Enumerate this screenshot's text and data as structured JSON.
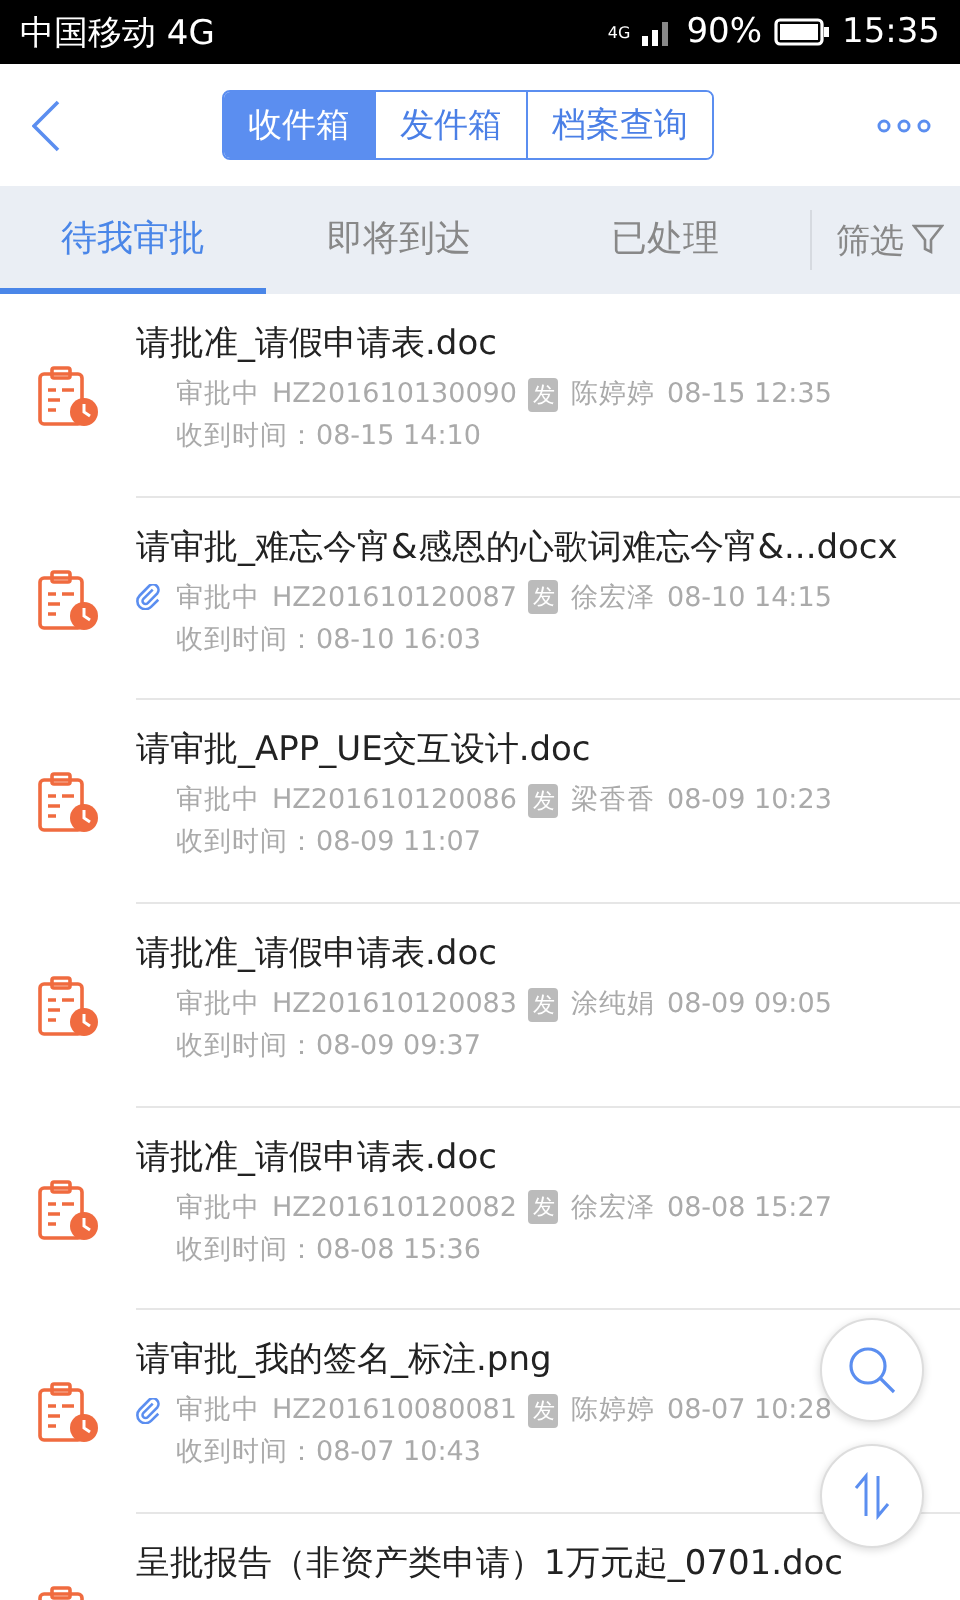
{
  "status_bar": {
    "carrier": "中国移动 4G",
    "network": "4G",
    "battery": "90%",
    "time": "15:35"
  },
  "segments": [
    {
      "label": "收件箱",
      "selected": true
    },
    {
      "label": "发件箱",
      "selected": false
    },
    {
      "label": "档案查询",
      "selected": false
    }
  ],
  "tabs": [
    {
      "label": "待我审批",
      "selected": true
    },
    {
      "label": "即将到达",
      "selected": false
    },
    {
      "label": "已处理",
      "selected": false
    }
  ],
  "filter": "筛选",
  "items": [
    {
      "title": "请批准_请假申请表.doc",
      "attachment": false,
      "status": "审批中",
      "code": "HZ201610130090",
      "tag": "发",
      "sender": "陈婷婷",
      "sent": "08-15 12:35",
      "received": "收到时间：08-15 14:10"
    },
    {
      "title": "请审批_难忘今宵&感恩的心歌词难忘今宵&...docx",
      "attachment": true,
      "status": "审批中",
      "code": "HZ201610120087",
      "tag": "发",
      "sender": "徐宏泽",
      "sent": "08-10 14:15",
      "received": "收到时间：08-10 16:03"
    },
    {
      "title": "请审批_APP_UE交互设计.doc",
      "attachment": false,
      "status": "审批中",
      "code": "HZ201610120086",
      "tag": "发",
      "sender": "梁香香",
      "sent": "08-09 10:23",
      "received": "收到时间：08-09 11:07"
    },
    {
      "title": "请批准_请假申请表.doc",
      "attachment": false,
      "status": "审批中",
      "code": "HZ201610120083",
      "tag": "发",
      "sender": "涂纯娟",
      "sent": "08-09 09:05",
      "received": "收到时间：08-09 09:37"
    },
    {
      "title": "请批准_请假申请表.doc",
      "attachment": false,
      "status": "审批中",
      "code": "HZ201610120082",
      "tag": "发",
      "sender": "徐宏泽",
      "sent": "08-08 15:27",
      "received": "收到时间：08-08 15:36"
    },
    {
      "title": "请审批_我的签名_标注.png",
      "attachment": true,
      "status": "审批中",
      "code": "HZ201610080081",
      "tag": "发",
      "sender": "陈婷婷",
      "sent": "08-07 10:28",
      "received": "收到时间：08-07 10:43"
    },
    {
      "title": "呈批报告（非资产类申请）1万元起_0701.doc"
    }
  ]
}
